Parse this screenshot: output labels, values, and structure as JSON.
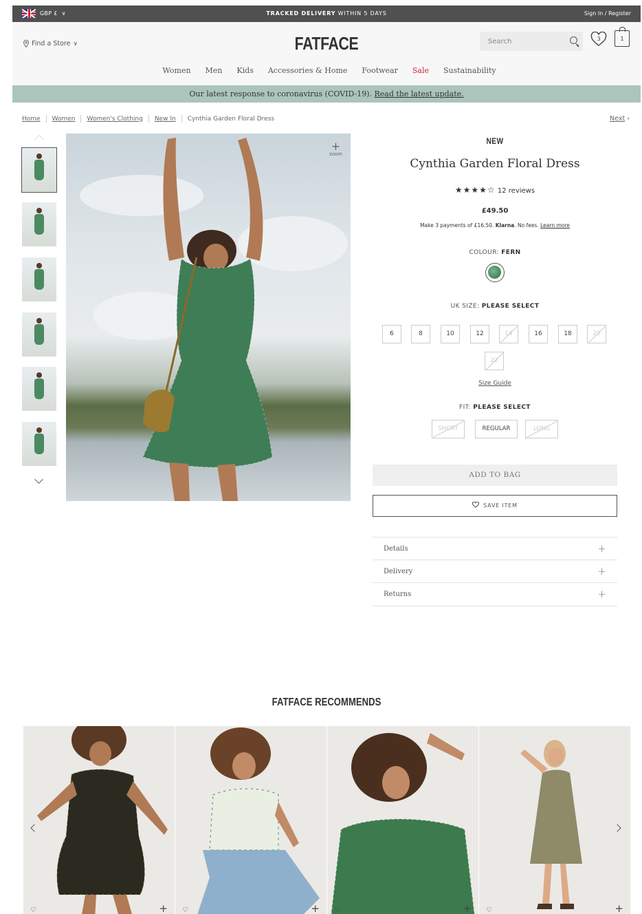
{
  "topbar": {
    "currency": "GBP £",
    "tracked_bold": "TRACKED DELIVERY",
    "tracked_rest": " WITHIN 5 DAYS",
    "signin": "Sign In / Register"
  },
  "header": {
    "find_store": "Find a Store",
    "logo": "FATFACE",
    "search_placeholder": "Search",
    "wishlist_count": "3",
    "bag_count": "1"
  },
  "nav": {
    "items": [
      "Women",
      "Men",
      "Kids",
      "Accessories & Home",
      "Footwear",
      "Sale",
      "Sustainability"
    ]
  },
  "covid": {
    "text": "Our latest response to coronavirus (COVID-19). ",
    "link": "Read the latest update."
  },
  "breadcrumb": {
    "items": [
      "Home",
      "Women",
      "Women's Clothing",
      "New In"
    ],
    "current": "Cynthia Garden Floral Dress",
    "next": "Next"
  },
  "gallery": {
    "zoom_label": "zoom",
    "zoom_symbol": "+"
  },
  "product": {
    "badge": "NEW",
    "title": "Cynthia Garden Floral Dress",
    "stars": "★★★★☆",
    "reviews": "12 reviews",
    "price": "£49.50",
    "klarna_prefix": "Make 3 payments of £16.50. ",
    "klarna_brand": "Klarna",
    "klarna_suffix": ". No fees. ",
    "klarna_link": "Learn more",
    "colour_label": "COLOUR: ",
    "colour_value": "FERN",
    "size_label": "UK SIZE: ",
    "size_value": "PLEASE SELECT",
    "sizes": [
      "6",
      "8",
      "10",
      "12",
      "14",
      "16",
      "18",
      "20",
      "22"
    ],
    "size_guide": "Size Guide",
    "fit_label": "FIT: ",
    "fit_value": "PLEASE SELECT",
    "fits": [
      "SHORT",
      "REGULAR",
      "LONG"
    ],
    "add_to_bag": "ADD TO BAG",
    "save_item": "SAVE ITEM",
    "accordions": [
      "Details",
      "Delivery",
      "Returns"
    ]
  },
  "recommends": {
    "title": "FATFACE RECOMMENDS"
  },
  "colors": {
    "topbar": "#505050",
    "covid_banner": "#abc5bc",
    "sale": "#d4213d",
    "dress_green": "#3f7d57"
  }
}
